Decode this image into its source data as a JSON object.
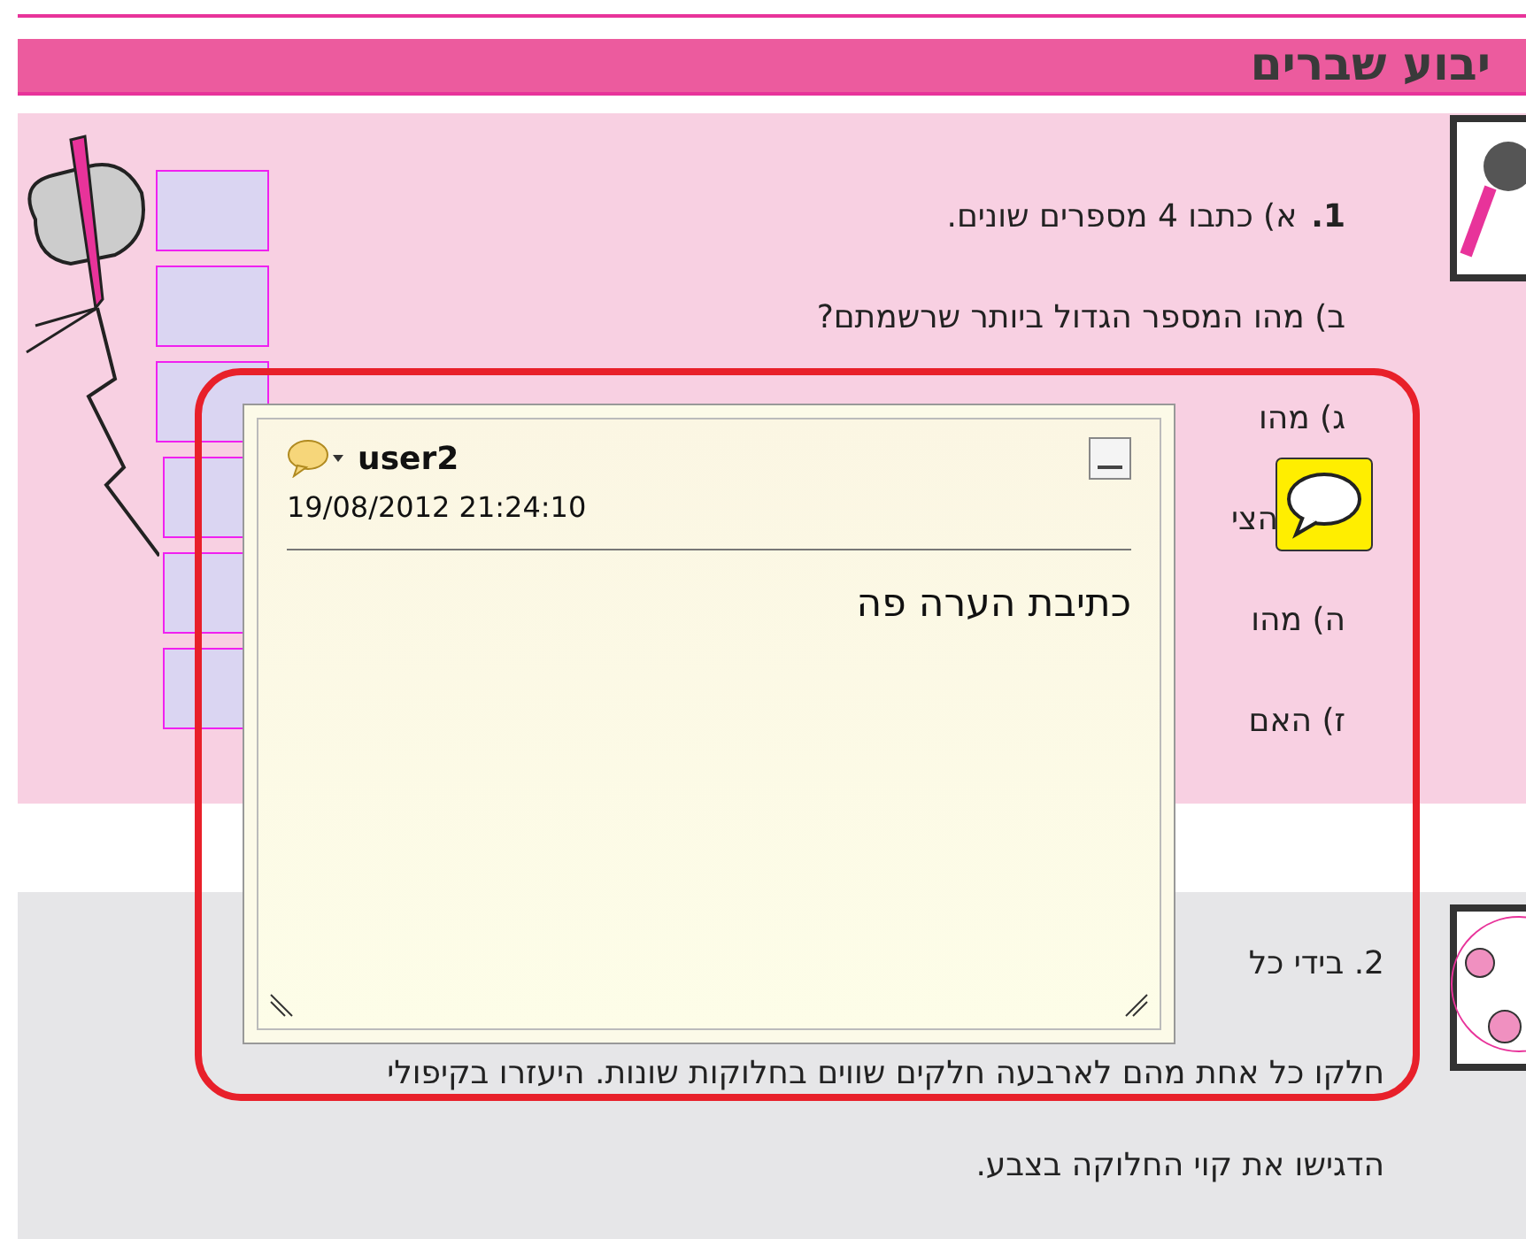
{
  "header": {
    "title": "יבוע שברים"
  },
  "section_1": {
    "number": "1.",
    "lines": [
      "א) כתבו 4 מספרים שונים.",
      "ב) מהו המספר הגדול ביותר שרשמתם?",
      "ג) מהו",
      "הצי",
      "ה) מהו",
      "ז) האם"
    ]
  },
  "section_2": {
    "lines": [
      "2. בידי כל",
      "חלקו כל אחת מהם לארבעה חלקים שווים בחלוקות שונות. היעזרו בקיפולי",
      "הדגישו את קוי החלוקה בצבע."
    ]
  },
  "comment": {
    "author": "user2",
    "timestamp": "19/08/2012 21:24:10",
    "text": "כתיבת הערה פה",
    "highlighted": true
  }
}
